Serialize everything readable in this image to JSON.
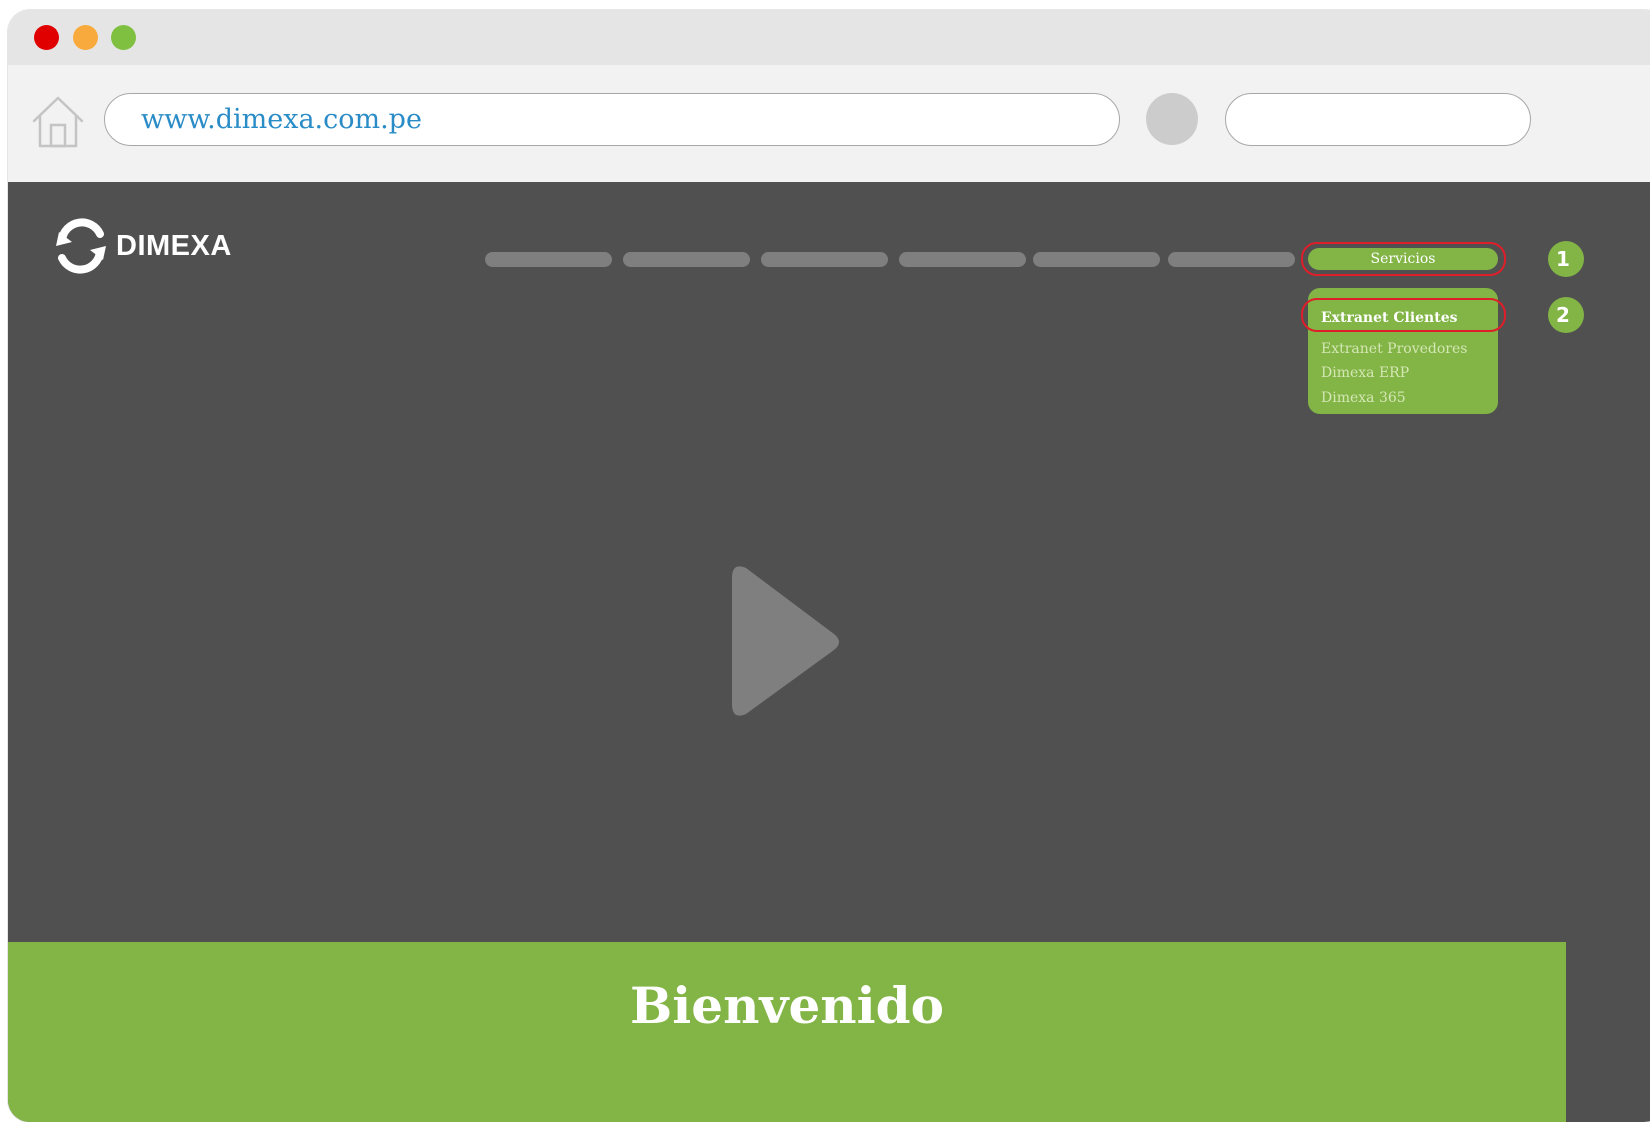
{
  "browser": {
    "url": "www.dimexa.com.pe",
    "url_color": "#2a8cc7",
    "traffic_lights": {
      "close": "#e00000",
      "minimize": "#f8ab3c",
      "zoom": "#7fc040"
    }
  },
  "brand": {
    "logo_text": "DIMEXA",
    "accent": "#82b446"
  },
  "nav": {
    "servicios_label": "Servicios"
  },
  "dropdown": {
    "items": [
      "Extranet Clientes",
      "Extranet Provedores",
      "Dimexa ERP",
      "Dimexa 365"
    ]
  },
  "steps": {
    "one": "1",
    "two": "2"
  },
  "hero": {
    "welcome": "Bienvenido",
    "play_icon": "play-icon"
  }
}
